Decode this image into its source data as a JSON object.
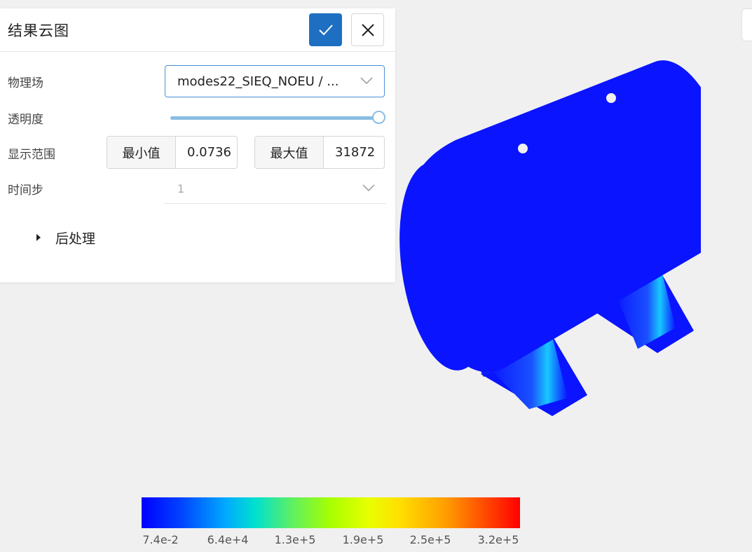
{
  "panel": {
    "title": "结果云图",
    "fields": {
      "physical_field_label": "物理场",
      "physical_field_value": "modes22_SIEQ_NOEU / ...",
      "transparency_label": "透明度",
      "transparency_value": 1.0,
      "display_range_label": "显示范围",
      "min_label": "最小值",
      "min_value": "0.0736",
      "max_label": "最大值",
      "max_value": "31872",
      "timestep_label": "时间步",
      "timestep_value": "1"
    },
    "post_processing_label": "后处理"
  },
  "colorbar": {
    "ticks": [
      "7.4e-2",
      "6.4e+4",
      "1.3e+5",
      "1.9e+5",
      "2.5e+5",
      "3.2e+5"
    ],
    "colors": [
      "#0000ff",
      "#00a8ff",
      "#a8ff00",
      "#ffe000",
      "#ffa000",
      "#ff0000"
    ]
  },
  "icons": {
    "confirm": "check-icon",
    "close": "close-icon",
    "dropdown": "chevron-down-icon",
    "expand": "caret-right-icon"
  },
  "colors": {
    "accent": "#1e6fc2",
    "model_base": "#0a14ff"
  }
}
